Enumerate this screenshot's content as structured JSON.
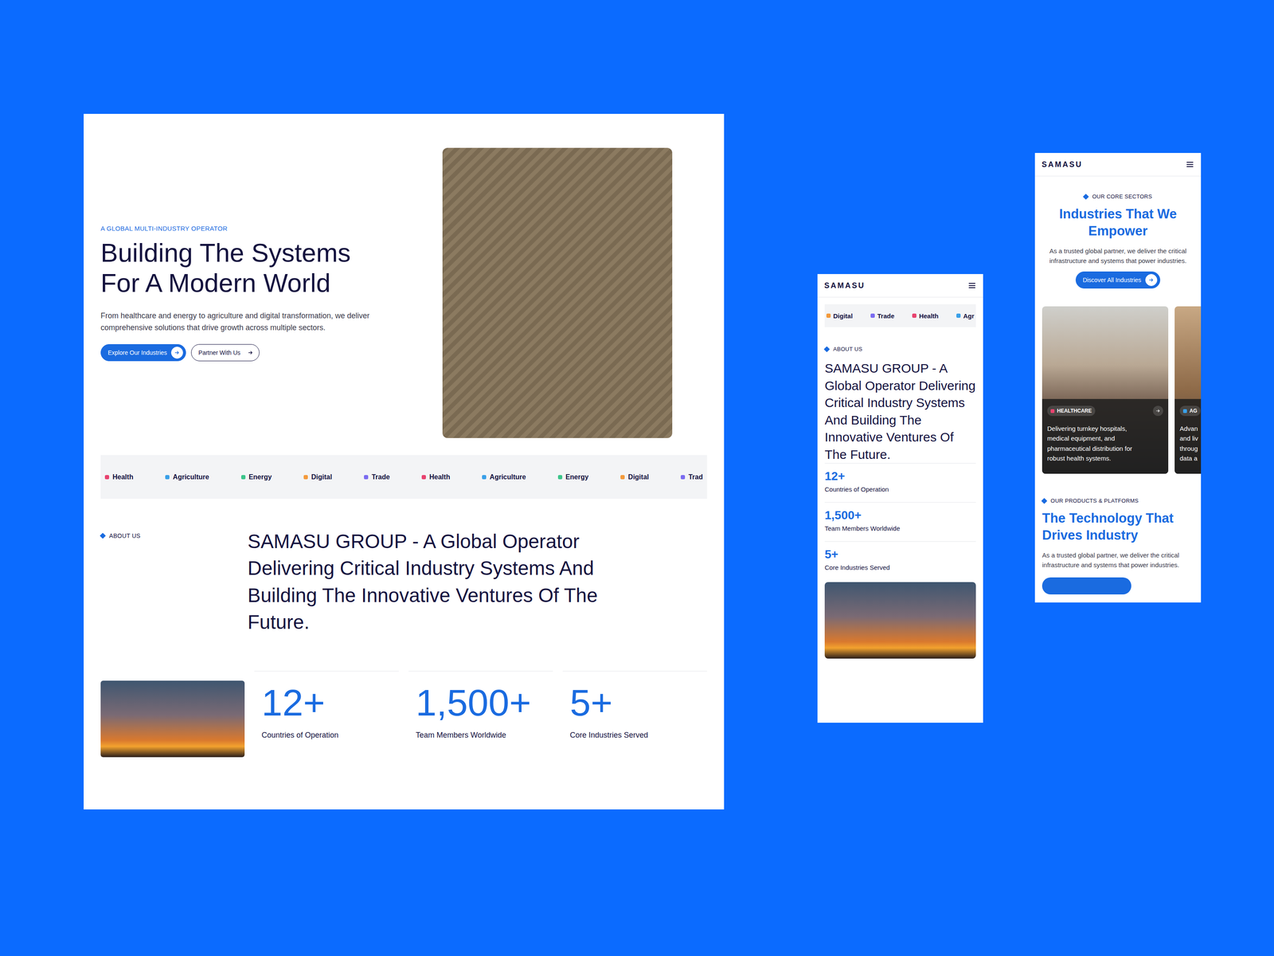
{
  "desktop": {
    "hero": {
      "eyebrow": "A GLOBAL MULTI-INDUSTRY OPERATOR",
      "title_lines": [
        "Building The Systems",
        "For A Modern World"
      ],
      "description": "From healthcare and energy to agriculture and digital transformation, we deliver comprehensive solutions that drive growth across multiple sectors.",
      "buttons": [
        {
          "label": "Explore Our Industries",
          "kind": "primary"
        },
        {
          "label": "Partner With Us",
          "kind": "outline"
        }
      ]
    },
    "marquee": [
      {
        "label": "Health",
        "color": "#e8436f"
      },
      {
        "label": "Agriculture",
        "color": "#3aa0e8"
      },
      {
        "label": "Energy",
        "color": "#3cc48a"
      },
      {
        "label": "Digital",
        "color": "#f39a3c"
      },
      {
        "label": "Trade",
        "color": "#7b6cf0"
      },
      {
        "label": "Health",
        "color": "#e8436f"
      },
      {
        "label": "Agriculture",
        "color": "#3aa0e8"
      },
      {
        "label": "Energy",
        "color": "#3cc48a"
      },
      {
        "label": "Digital",
        "color": "#f39a3c"
      },
      {
        "label": "Trad",
        "color": "#7b6cf0"
      }
    ],
    "about": {
      "eyebrow": "ABOUT US",
      "statement": "SAMASU GROUP - A Global Operator Delivering Critical Industry Systems And Building The Innovative Ventures Of The Future."
    },
    "stats": [
      {
        "value": "12+",
        "label": "Countries of Operation"
      },
      {
        "value": "1,500+",
        "label": "Team Members Worldwide"
      },
      {
        "value": "5+",
        "label": "Core Industries Served"
      }
    ]
  },
  "mobile_about": {
    "logo": "SAMASU",
    "marquee": [
      {
        "label": "Digital",
        "color": "#f39a3c"
      },
      {
        "label": "Trade",
        "color": "#7b6cf0"
      },
      {
        "label": "Health",
        "color": "#e8436f"
      },
      {
        "label": "Agr",
        "color": "#3aa0e8"
      }
    ],
    "about": {
      "eyebrow": "ABOUT US",
      "statement": "SAMASU GROUP - A Global Operator Delivering Critical Industry Systems And Building The Innovative Ventures Of The Future."
    },
    "stats": [
      {
        "value": "12+",
        "label": "Countries of Operation"
      },
      {
        "value": "1,500+",
        "label": "Team Members Worldwide"
      },
      {
        "value": "5+",
        "label": "Core Industries Served"
      }
    ]
  },
  "mobile_sectors": {
    "logo": "SAMASU",
    "eyebrow": "OUR CORE SECTORS",
    "title": "Industries That We Empower",
    "description": "As a trusted global partner, we deliver the critical infrastructure and systems that power industries.",
    "button": "Discover All Industries",
    "cards": [
      {
        "tag": "HEALTHCARE",
        "color": "#e8436f",
        "description_lines": [
          "Delivering turnkey hospitals,",
          "medical equipment, and",
          "pharmaceutical distribution for",
          "robust health systems."
        ]
      },
      {
        "tag": "AG",
        "color": "#3aa0e8",
        "description_lines": [
          "Advan",
          "and liv",
          "throug",
          "data a"
        ]
      }
    ],
    "products": {
      "eyebrow": "OUR PRODUCTS & PLATFORMS",
      "title": "The Technology That Drives Industry",
      "description": "As a trusted global partner, we deliver the critical infrastructure and systems that power industries."
    }
  }
}
